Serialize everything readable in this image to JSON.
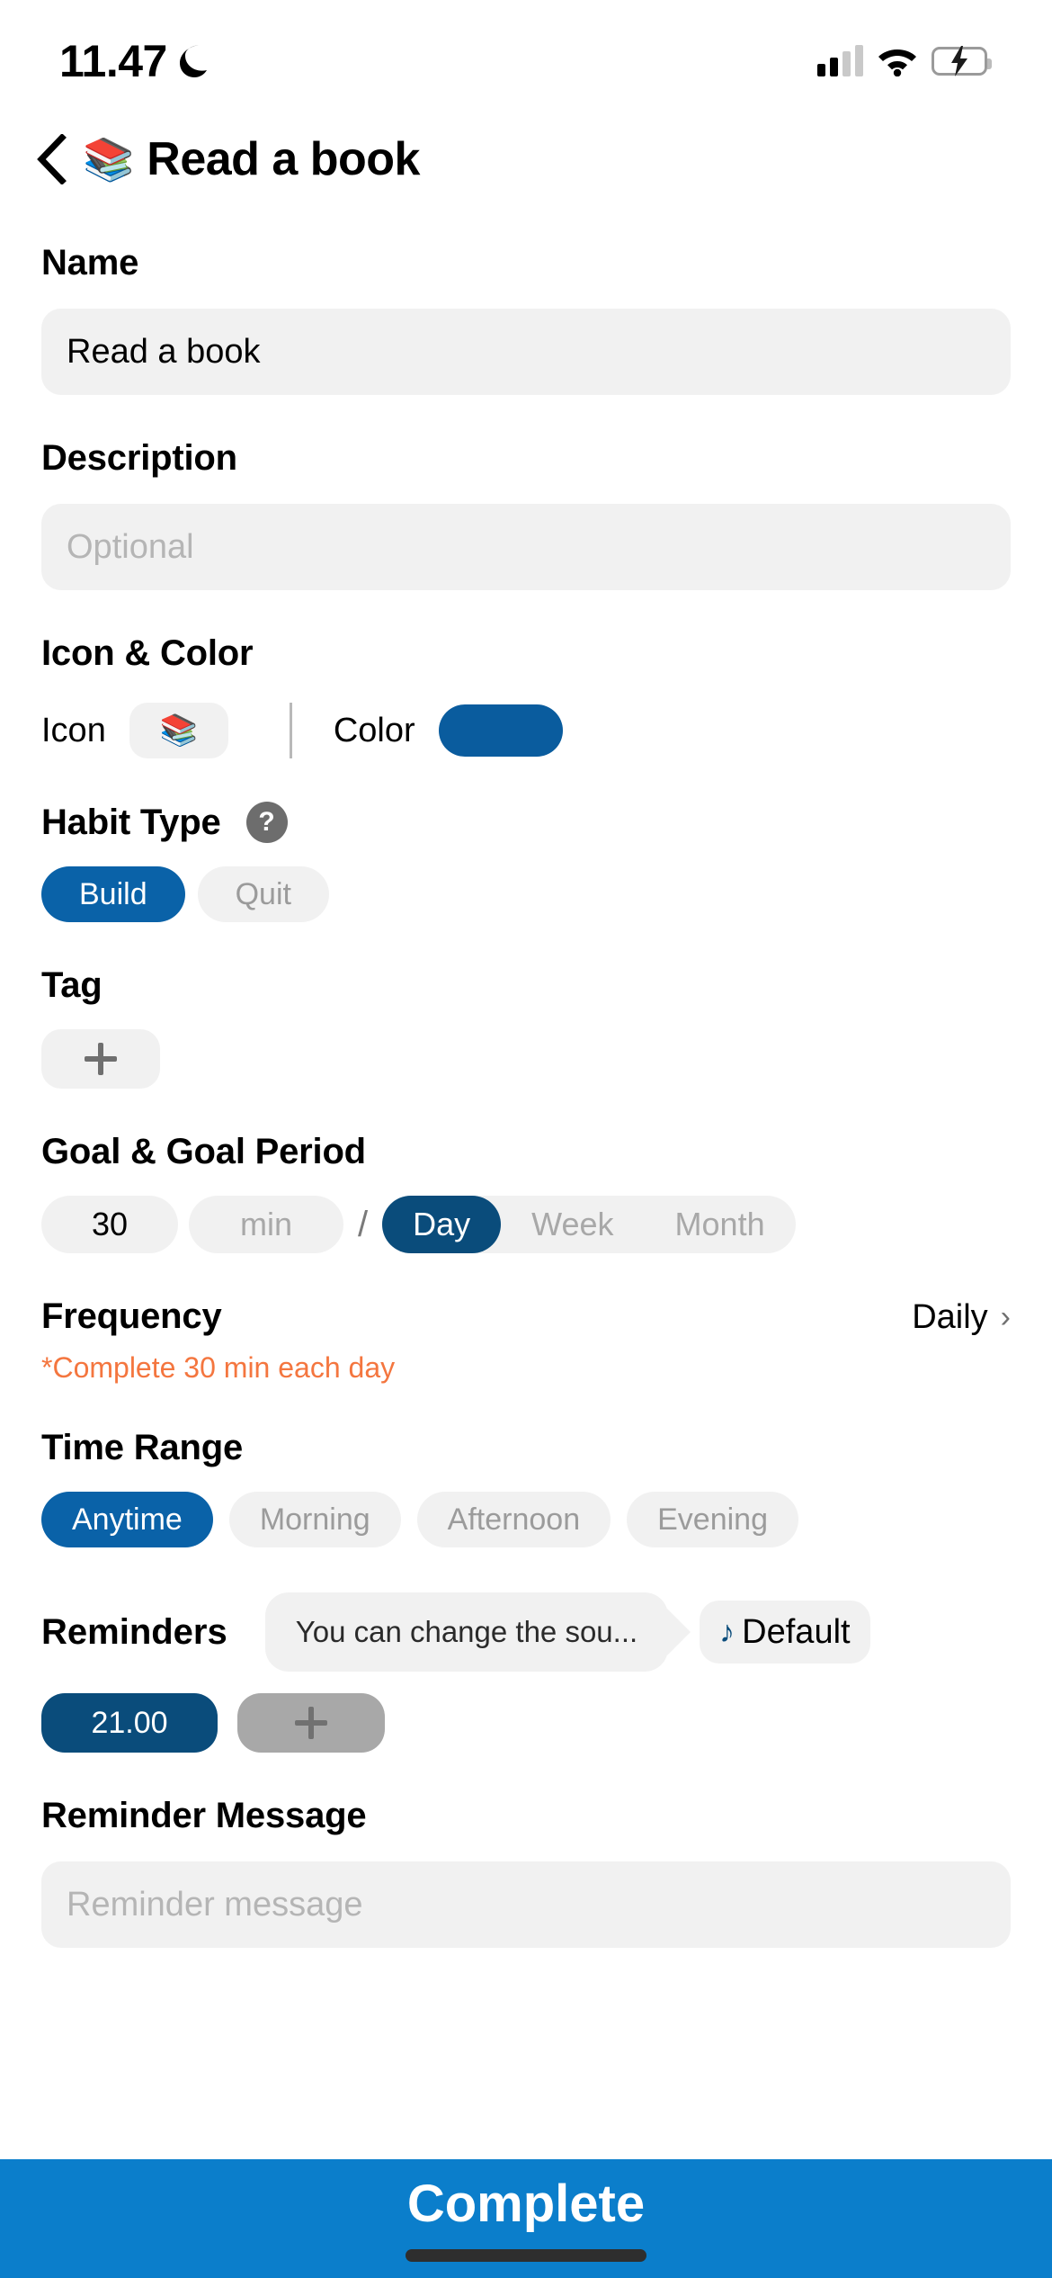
{
  "status_bar": {
    "time": "11.47",
    "dnd_icon": "crescent-moon-icon",
    "signal_icon": "cellular-signal-icon",
    "wifi_icon": "wifi-icon",
    "battery_icon": "battery-charging-icon"
  },
  "header": {
    "back_icon": "back-chevron-icon",
    "emoji": "📚",
    "title": "Read a book"
  },
  "name": {
    "label": "Name",
    "value": "Read a book"
  },
  "description": {
    "label": "Description",
    "placeholder": "Optional",
    "value": ""
  },
  "icon_color": {
    "section_label": "Icon & Color",
    "icon_label": "Icon",
    "icon_value": "📚",
    "color_label": "Color",
    "color_value": "#0a5c9e"
  },
  "habit_type": {
    "label": "Habit Type",
    "help_icon": "?",
    "options": [
      {
        "label": "Build",
        "selected": true
      },
      {
        "label": "Quit",
        "selected": false
      }
    ]
  },
  "tag": {
    "label": "Tag",
    "add_icon": "plus-icon"
  },
  "goal": {
    "label": "Goal & Goal Period",
    "amount": "30",
    "unit": "min",
    "separator": "/",
    "periods": [
      {
        "label": "Day",
        "selected": true
      },
      {
        "label": "Week",
        "selected": false
      },
      {
        "label": "Month",
        "selected": false
      }
    ]
  },
  "frequency": {
    "label": "Frequency",
    "value": "Daily",
    "chevron": "›",
    "hint": "*Complete 30 min each day"
  },
  "time_range": {
    "label": "Time Range",
    "options": [
      {
        "label": "Anytime",
        "selected": true
      },
      {
        "label": "Morning",
        "selected": false
      },
      {
        "label": "Afternoon",
        "selected": false
      },
      {
        "label": "Evening",
        "selected": false
      }
    ]
  },
  "reminders": {
    "label": "Reminders",
    "tooltip": "You can change the sou...",
    "sound_icon": "♪",
    "sound_value": "Default",
    "times": [
      "21.00"
    ],
    "add_icon": "plus-icon"
  },
  "reminder_message": {
    "label": "Reminder Message",
    "placeholder": "Reminder message",
    "value": ""
  },
  "footer": {
    "complete_label": "Complete"
  }
}
